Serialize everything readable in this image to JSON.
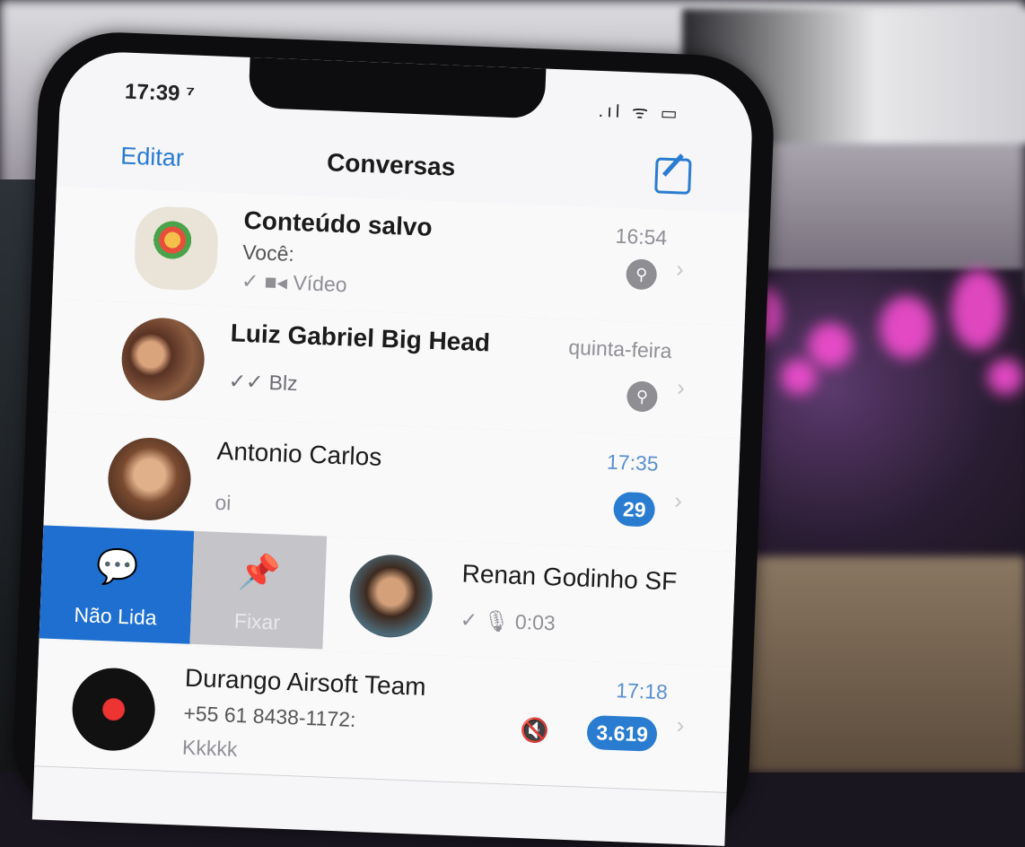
{
  "status_bar": {
    "time": "17:39 ⁷",
    "icons": ".ıl ᯤ ▭"
  },
  "nav": {
    "edit_label": "Editar",
    "title": "Conversas"
  },
  "chats": [
    {
      "title": "Conteúdo salvo",
      "time": "16:54",
      "sender": "Você:",
      "message": "✓ ■◂ Vídeo",
      "pinned": true
    },
    {
      "title": "Luiz Gabriel Big Head",
      "time": "quinta-feira",
      "message": "✓✓ Blz",
      "pinned": true
    },
    {
      "title": "Antonio Carlos",
      "time": "17:35",
      "message": "oi",
      "badge": "29"
    },
    {
      "title": "Renan Godinho SF",
      "message": "✓ 🎙 0:03"
    },
    {
      "title": "Durango Airsoft Team",
      "time": "17:18",
      "sender": "+55 61 8438-1172:",
      "message": "Kkkkk",
      "badge": "3.619",
      "muted": true
    }
  ],
  "swipe_actions": {
    "unread_label": "Não Lida",
    "pin_label": "Fixar"
  },
  "colors": {
    "accent": "#2a7cd1",
    "unread_action": "#1e6fcf",
    "pin_action": "#c4c4c9"
  },
  "icons": [
    "compose-icon",
    "pin-icon",
    "chevron-right-icon",
    "mute-icon",
    "unread-bubble-icon"
  ]
}
